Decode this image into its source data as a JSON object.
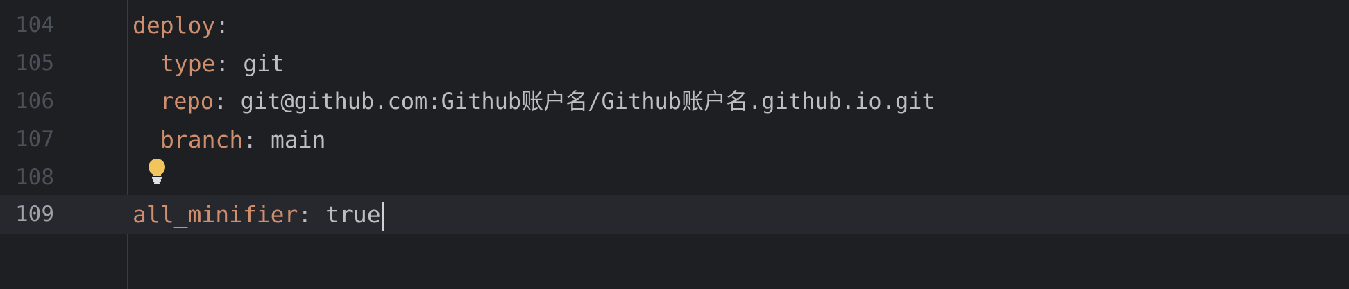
{
  "editor": {
    "lines": [
      {
        "number": "104",
        "key": "deploy",
        "sep": ":",
        "value": ""
      },
      {
        "number": "105",
        "key": "type",
        "sep": ": ",
        "value": "git"
      },
      {
        "number": "106",
        "key": "repo",
        "sep": ": ",
        "value": "git@github.com:Github账户名/Github账户名.github.io.git"
      },
      {
        "number": "107",
        "key": "branch",
        "sep": ": ",
        "value": "main"
      },
      {
        "number": "108",
        "key": "",
        "sep": "",
        "value": ""
      },
      {
        "number": "109",
        "key": "all_minifier",
        "sep": ": ",
        "value": "true"
      }
    ],
    "current_line": "109",
    "intention_icon": "lightbulb-icon"
  }
}
